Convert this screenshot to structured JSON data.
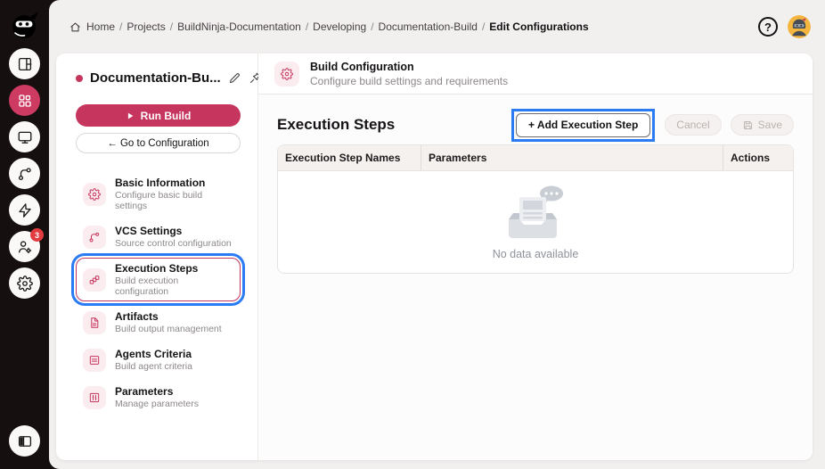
{
  "topbar": {
    "breadcrumb": [
      {
        "label": "Home",
        "icon": "home-icon"
      },
      {
        "label": "Projects"
      },
      {
        "label": "BuildNinja-Documentation"
      },
      {
        "label": "Developing"
      },
      {
        "label": "Documentation-Build"
      },
      {
        "label": "Edit Configurations",
        "current": true
      }
    ],
    "separator": "/",
    "help_label": "?"
  },
  "rail": {
    "items": [
      {
        "icon": "layout-icon",
        "active": false
      },
      {
        "icon": "apps-grid-icon",
        "active": true
      },
      {
        "icon": "monitor-icon",
        "active": false
      },
      {
        "icon": "git-branch-icon",
        "active": false
      },
      {
        "icon": "lightning-icon",
        "active": false
      },
      {
        "icon": "user-gear-icon",
        "active": false,
        "badge": "3"
      },
      {
        "icon": "settings-icon",
        "active": false
      }
    ],
    "badge_count": "3",
    "bottom_icon": "collapse-sidebar-icon"
  },
  "config_panel": {
    "title": "Documentation-Bu...",
    "run_build_label": "Run Build",
    "goto_config_label": "← Go to Configuration",
    "menu": [
      {
        "label": "Basic Information",
        "description": "Configure basic build settings",
        "icon": "gear-icon"
      },
      {
        "label": "VCS Settings",
        "description": "Source control configuration",
        "icon": "git-branch-icon"
      },
      {
        "label": "Execution Steps",
        "description": "Build execution configuration",
        "icon": "steps-icon",
        "selected": true
      },
      {
        "label": "Artifacts",
        "description": "Build output management",
        "icon": "document-icon"
      },
      {
        "label": "Agents Criteria",
        "description": "Build agent criteria",
        "icon": "agent-icon"
      },
      {
        "label": "Parameters",
        "description": "Manage parameters",
        "icon": "parameters-icon"
      }
    ]
  },
  "main": {
    "header_title": "Build Configuration",
    "header_subtitle": "Configure build settings and requirements",
    "section_title": "Execution Steps",
    "add_step_label": "+ Add Execution Step",
    "cancel_label": "Cancel",
    "save_label": "Save",
    "table": {
      "columns": [
        "Execution Step Names",
        "Parameters",
        "Actions"
      ],
      "rows": [],
      "empty_text": "No data available"
    }
  },
  "colors": {
    "accent": "#c6355e",
    "accent_light": "#fbecf0",
    "annotation_blue": "#2b7bf3",
    "rail_bg": "#15100f",
    "page_bg": "#f2f0ef",
    "badge_red": "#e23c41",
    "avatar_yellow": "#f3b53d"
  }
}
